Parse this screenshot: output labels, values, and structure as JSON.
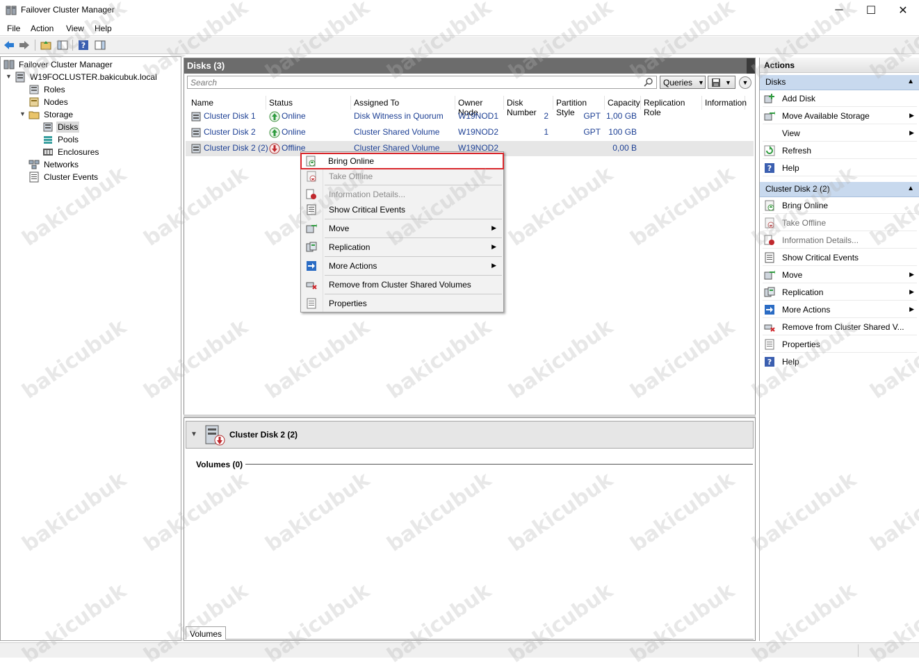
{
  "window": {
    "title": "Failover Cluster Manager",
    "minimize": "─",
    "maximize": "☐",
    "close": "✕"
  },
  "menu": [
    "File",
    "Action",
    "View",
    "Help"
  ],
  "tree": {
    "root": "Failover Cluster Manager",
    "cluster": "W19FOCLUSTER.bakicubuk.local",
    "roles": "Roles",
    "nodes": "Nodes",
    "storage": "Storage",
    "disks": "Disks",
    "pools": "Pools",
    "enclosures": "Enclosures",
    "networks": "Networks",
    "events": "Cluster Events"
  },
  "center": {
    "title": "Disks (3)",
    "search_placeholder": "Search",
    "queries_label": "Queries",
    "columns": [
      "Name",
      "Status",
      "Assigned To",
      "Owner Node",
      "Disk Number",
      "Partition Style",
      "Capacity",
      "Replication Role",
      "Information"
    ],
    "rows": [
      {
        "name": "Cluster Disk 1",
        "status": "Online",
        "assigned": "Disk Witness in Quorum",
        "owner": "W19NOD1",
        "disk_number": "2",
        "partition": "GPT",
        "capacity": "1,00 GB"
      },
      {
        "name": "Cluster Disk 2",
        "status": "Online",
        "assigned": "Cluster Shared Volume",
        "owner": "W19NOD2",
        "disk_number": "1",
        "partition": "GPT",
        "capacity": "100 GB"
      },
      {
        "name": "Cluster Disk 2 (2)",
        "status": "Offline",
        "assigned": "Cluster Shared Volume",
        "owner": "W19NOD2",
        "disk_number": "",
        "partition": "",
        "capacity": "0,00 B"
      }
    ]
  },
  "detail": {
    "title": "Cluster Disk 2 (2)",
    "volumes_label": "Volumes (0)",
    "tab": "Volumes"
  },
  "context_menu": {
    "bring_online": "Bring Online",
    "take_offline": "Take Offline",
    "info_details": "Information Details...",
    "critical_events": "Show Critical Events",
    "move": "Move",
    "replication": "Replication",
    "more_actions": "More Actions",
    "remove_csv": "Remove from Cluster Shared Volumes",
    "properties": "Properties"
  },
  "actions": {
    "title": "Actions",
    "section1": "Disks",
    "add_disk": "Add Disk",
    "move_storage": "Move Available Storage",
    "view": "View",
    "refresh": "Refresh",
    "help1": "Help",
    "section2": "Cluster Disk 2 (2)",
    "bring_online": "Bring Online",
    "take_offline": "Take Offline",
    "info_details": "Information Details...",
    "critical_events": "Show Critical Events",
    "move": "Move",
    "replication": "Replication",
    "more_actions": "More Actions",
    "remove_csv": "Remove from Cluster Shared V...",
    "properties": "Properties",
    "help2": "Help"
  },
  "watermark": "bakicubuk",
  "colors": {
    "highlight_box": "#d9262b",
    "link_text": "#1c3f94",
    "section_blue": "#c8d9ee",
    "header_gray": "#6c6c6c"
  }
}
